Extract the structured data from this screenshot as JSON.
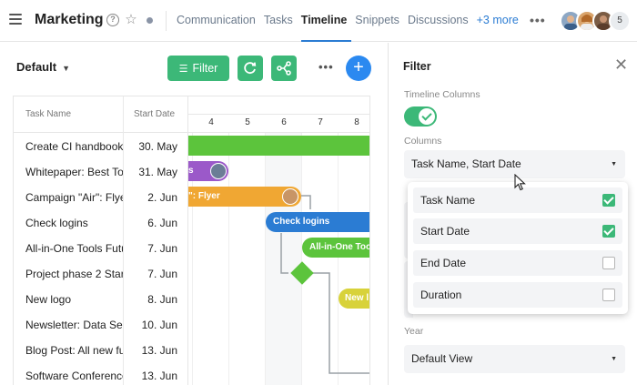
{
  "header": {
    "title": "Marketing",
    "tabs": [
      {
        "label": "Communication",
        "active": false
      },
      {
        "label": "Tasks",
        "active": false
      },
      {
        "label": "Timeline",
        "active": true
      },
      {
        "label": "Snippets",
        "active": false
      },
      {
        "label": "Discussions",
        "active": false
      }
    ],
    "more_tabs": "+3 more",
    "member_count": "5",
    "accent_color": "#2b7cd3"
  },
  "toolbar": {
    "view": "Default",
    "filter_label": "Filter",
    "button_color": "#3cb878",
    "add_color": "#2b89f0"
  },
  "task_table": {
    "columns": [
      "Task Name",
      "Start Date"
    ],
    "rows": [
      {
        "name": "Create CI handbook",
        "start": "30. May"
      },
      {
        "name": "Whitepaper: Best To",
        "start": "31. May"
      },
      {
        "name": "Campaign \"Air\": Flye",
        "start": "2. Jun"
      },
      {
        "name": "Check logins",
        "start": "6. Jun"
      },
      {
        "name": "All-in-One Tools Futu",
        "start": "7. Jun"
      },
      {
        "name": "Project phase 2 Star",
        "start": "7. Jun"
      },
      {
        "name": "New logo",
        "start": "8. Jun"
      },
      {
        "name": "Newsletter: Data Sec",
        "start": "10. Jun"
      },
      {
        "name": "Blog Post: All new fu",
        "start": "13. Jun"
      },
      {
        "name": "Software Conference",
        "start": "13. Jun"
      }
    ]
  },
  "gantt": {
    "days": [
      "4",
      "5",
      "6",
      "7",
      "8"
    ],
    "bars": [
      {
        "label": "",
        "color": "#5cc43c"
      },
      {
        "label": "s",
        "color": "#9b59c9"
      },
      {
        "label": "\": Flyer",
        "color": "#f0a733"
      },
      {
        "label": "Check logins",
        "color": "#2b7cd3"
      },
      {
        "label": "All-in-One Too",
        "color": "#5cc43c"
      },
      {
        "label": "New l",
        "color": "#d8d23a"
      }
    ],
    "milestone_color": "#5cc43c"
  },
  "filter_panel": {
    "title": "Filter",
    "timeline_columns_label": "Timeline Columns",
    "timeline_columns_enabled": true,
    "columns_label": "Columns",
    "columns_value": "Task Name, Start Date",
    "column_options": [
      {
        "label": "Task Name",
        "checked": true
      },
      {
        "label": "Start Date",
        "checked": true
      },
      {
        "label": "End Date",
        "checked": false
      },
      {
        "label": "Duration",
        "checked": false
      }
    ],
    "year_label": "Year",
    "year_value": "Default View"
  }
}
